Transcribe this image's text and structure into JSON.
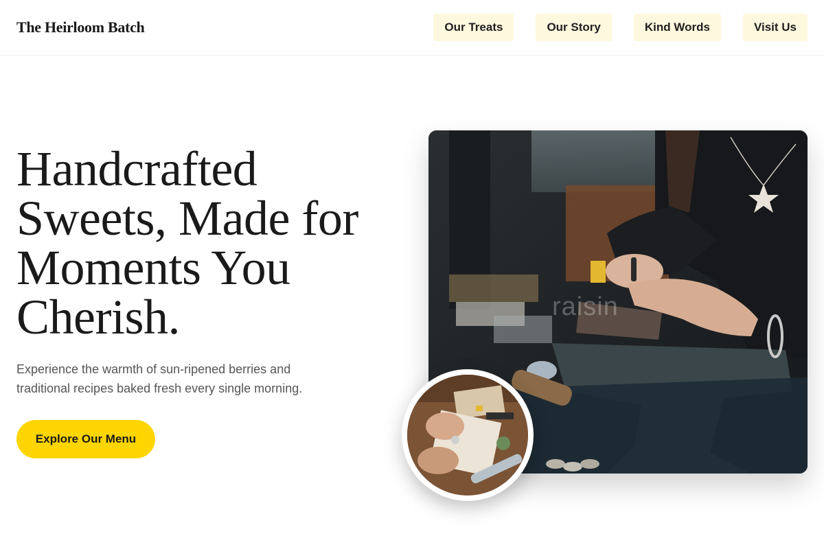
{
  "brand": {
    "name": "The Heirloom Batch"
  },
  "nav": {
    "items": [
      {
        "label": "Our Treats"
      },
      {
        "label": "Our Story"
      },
      {
        "label": "Kind Words"
      },
      {
        "label": "Visit Us"
      }
    ]
  },
  "hero": {
    "title": "Handcrafted Sweets, Made for Moments You Cherish.",
    "subtitle": "Experience the warmth of sun-ripened berries and traditional recipes baked fresh every single morning.",
    "cta_label": "Explore Our Menu"
  },
  "images": {
    "main": {
      "subject": "hands-crafting-at-anvil",
      "watermark": "raisin"
    },
    "inset": {
      "subject": "hands-working-at-desk"
    }
  },
  "colors": {
    "accent": "#ffd500",
    "nav_bg": "#fef8df",
    "text": "#1a1a1a",
    "muted": "#555555"
  }
}
